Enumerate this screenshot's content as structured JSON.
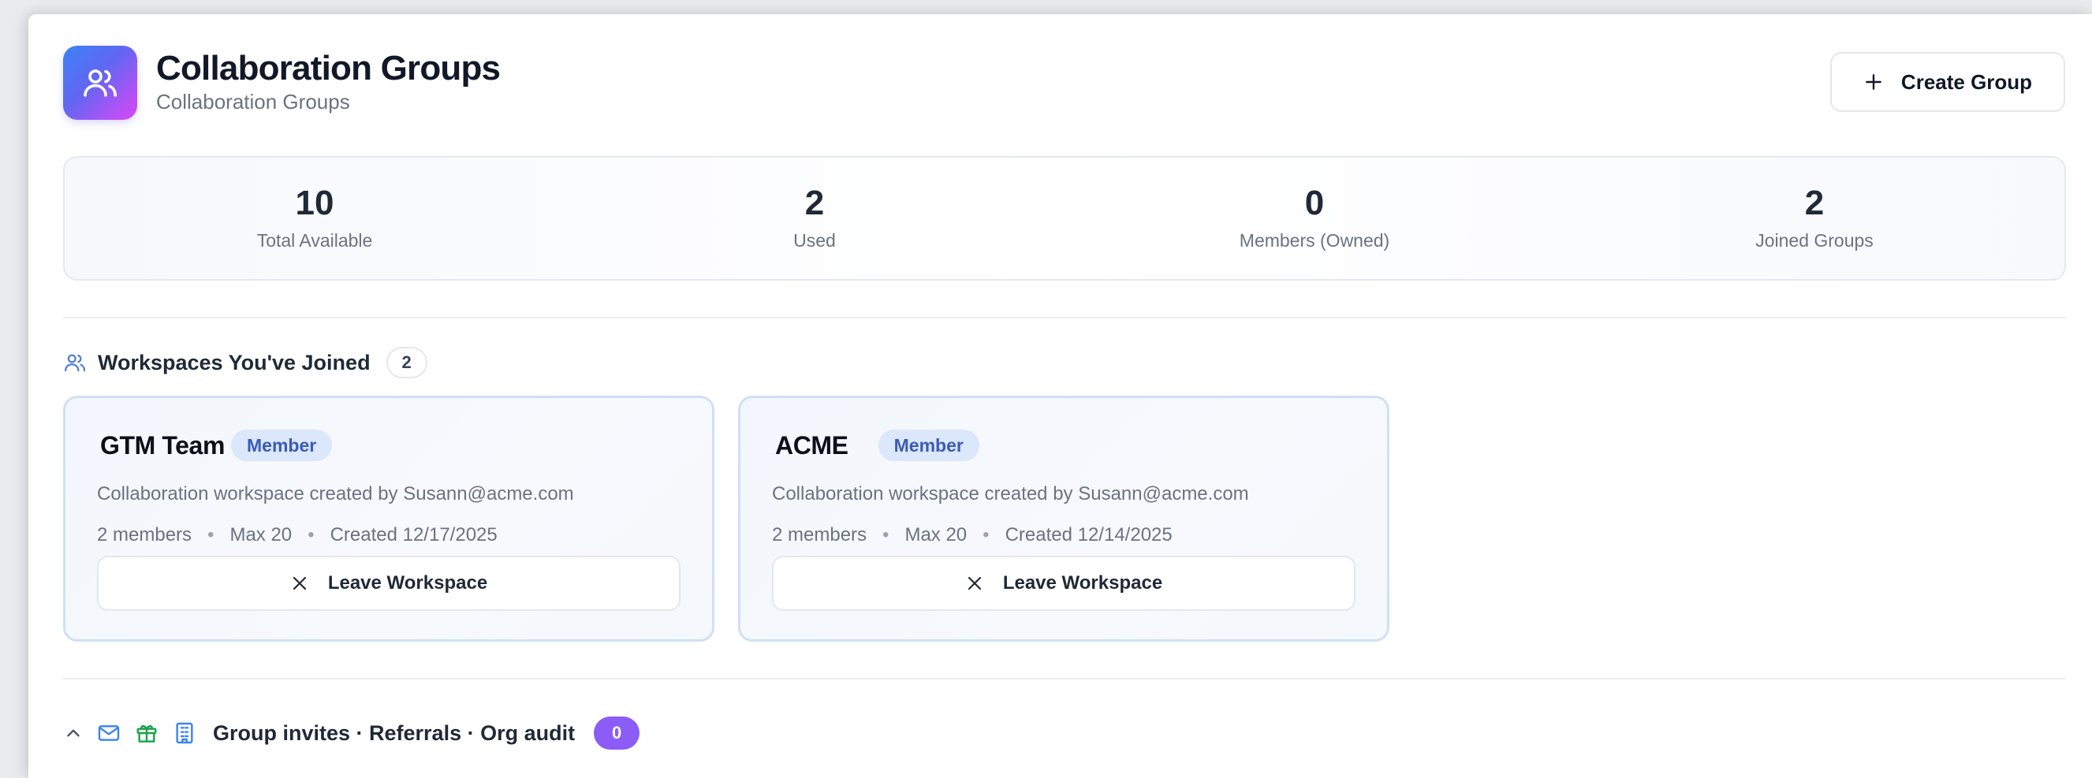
{
  "header": {
    "title": "Collaboration Groups",
    "subtitle": "Collaboration Groups",
    "app_icon": "users-icon",
    "create_button": "Create Group"
  },
  "stats": [
    {
      "value": "10",
      "label": "Total Available"
    },
    {
      "value": "2",
      "label": "Used"
    },
    {
      "value": "0",
      "label": "Members (Owned)"
    },
    {
      "value": "2",
      "label": "Joined Groups"
    }
  ],
  "joined": {
    "title": "Workspaces You've Joined",
    "count": "2",
    "cards": [
      {
        "name": "GTM Team",
        "badge": "Member",
        "description": "Collaboration workspace created by Susann@acme.com",
        "members": "2 members",
        "max": "Max 20",
        "created": "Created 12/17/2025",
        "leave_label": "Leave Workspace"
      },
      {
        "name": "ACME",
        "badge": "Member",
        "description": "Collaboration workspace created by Susann@acme.com",
        "members": "2 members",
        "max": "Max 20",
        "created": "Created 12/14/2025",
        "leave_label": "Leave Workspace"
      }
    ]
  },
  "invites": {
    "title": "Group invites · Referrals · Org audit",
    "count": "0"
  },
  "colors": {
    "accent_blue": "#3b82f6",
    "accent_purple": "#8b5cf6",
    "badge_bg": "#dbe7fb",
    "card_border": "#cfe0f5"
  }
}
